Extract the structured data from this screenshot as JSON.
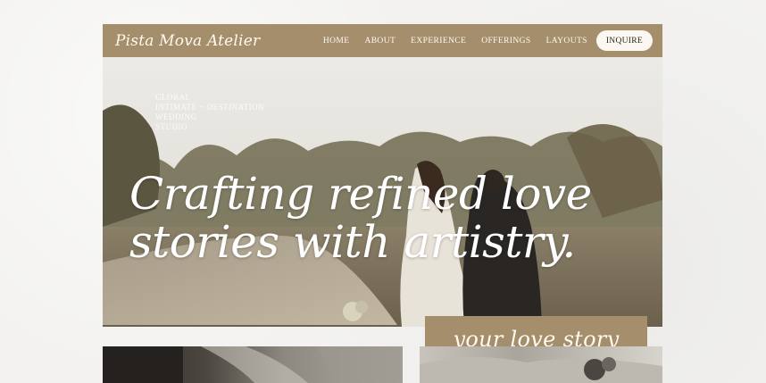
{
  "brand": {
    "name": "Pista Mova Atelier"
  },
  "nav": {
    "items": [
      {
        "label": "HOME"
      },
      {
        "label": "ABOUT"
      },
      {
        "label": "EXPERIENCE"
      },
      {
        "label": "OFFERINGS"
      },
      {
        "label": "LAYOUTS"
      }
    ],
    "cta_label": "INQUIRE"
  },
  "hero": {
    "tagline_lines": [
      "GLOBAL",
      "INTIMATE + DESTINATION",
      "WEDDING",
      "STUDIO"
    ],
    "headline_line1": "Crafting refined love",
    "headline_line2": "stories with artistry.",
    "image_icon": "couple-walking-photo"
  },
  "script_label": "your love story",
  "colors": {
    "accent": "#a48e6b",
    "page_bg": "#f3f2f0",
    "button_bg": "#fbf8f2",
    "text_light": "#fffaf0"
  }
}
